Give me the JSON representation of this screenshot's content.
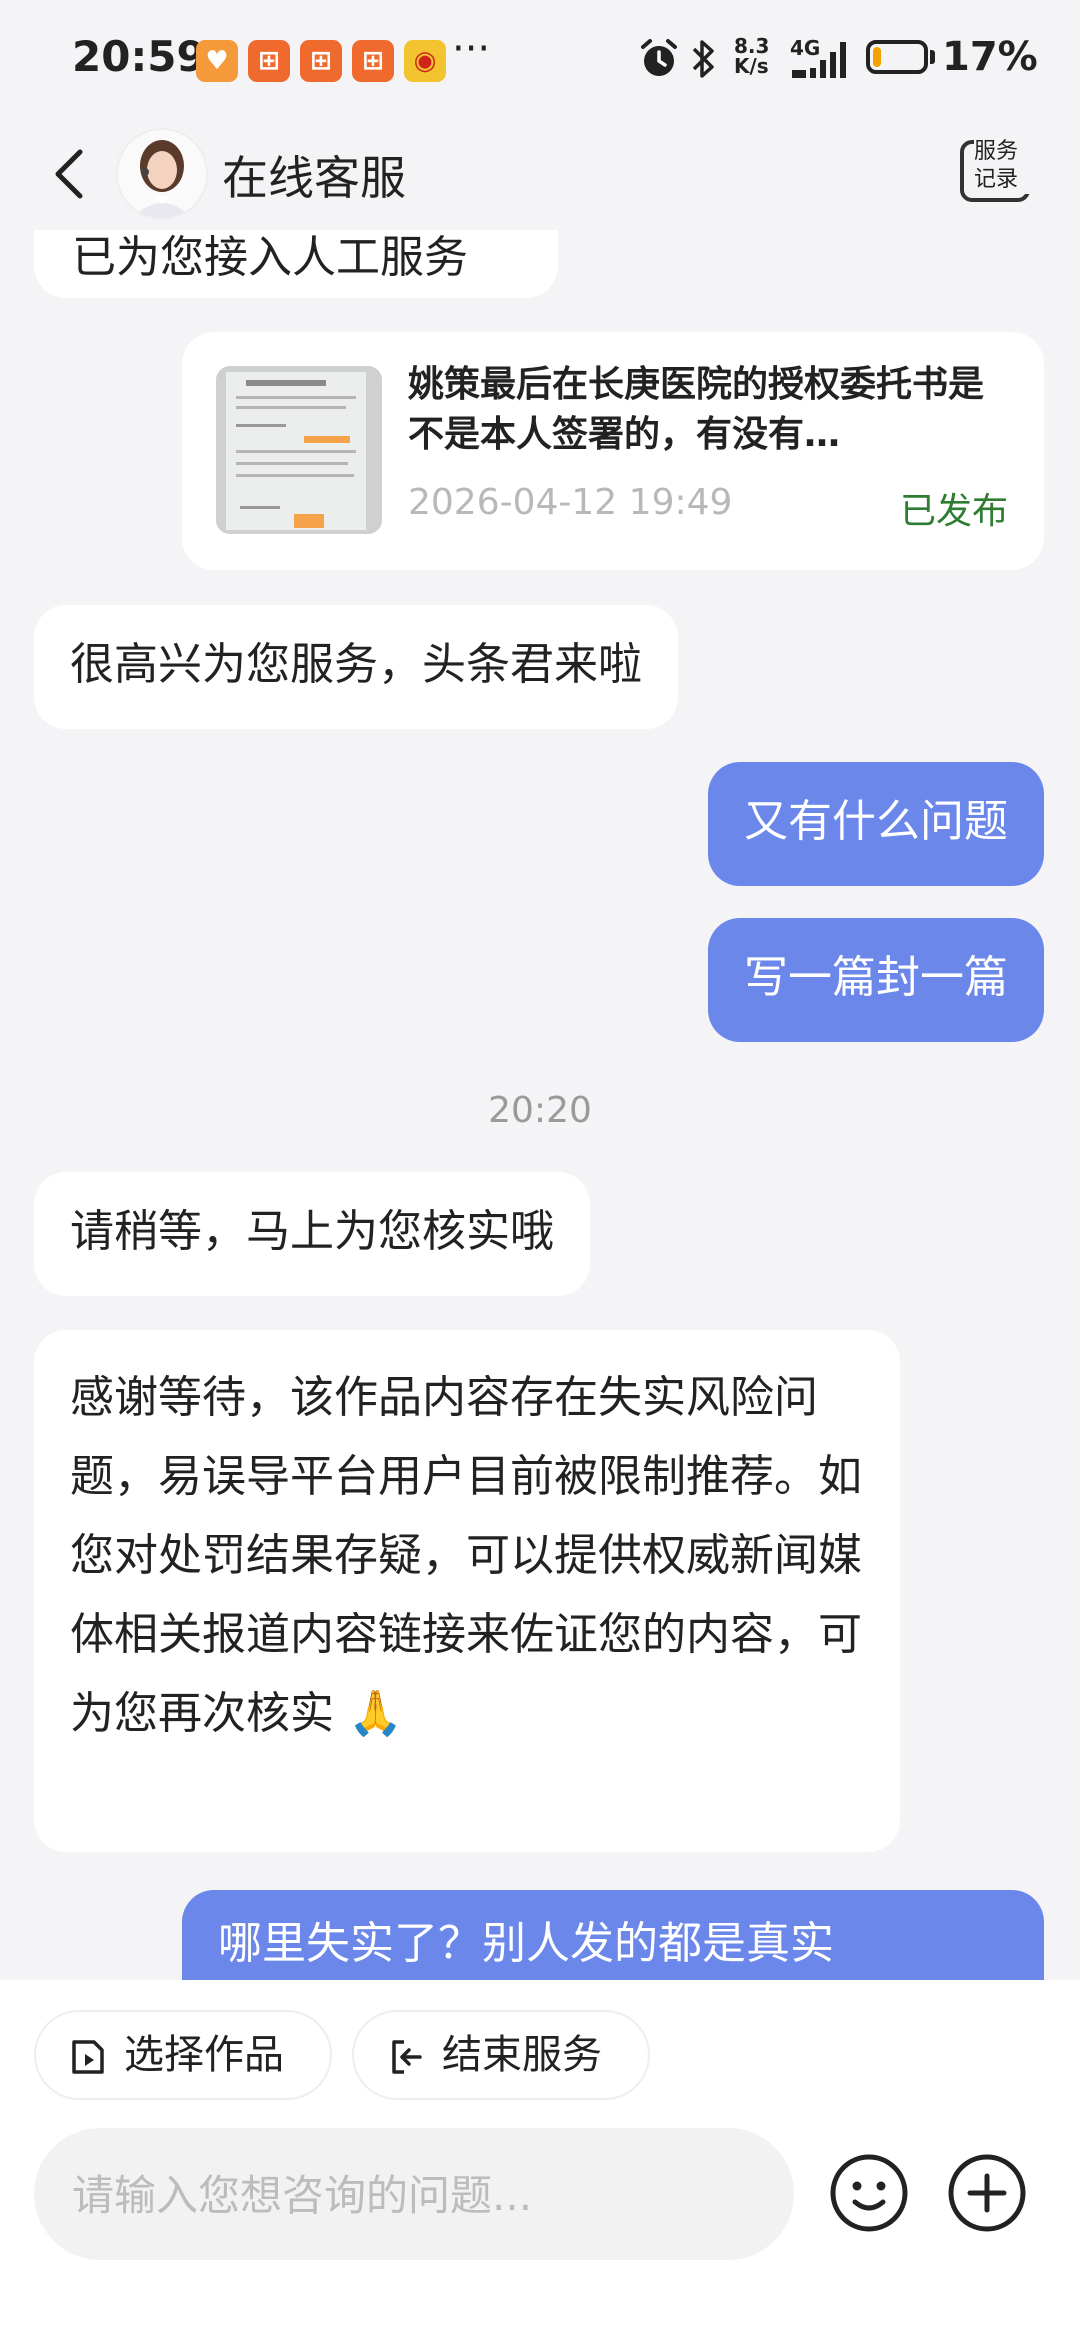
{
  "status_bar": {
    "time": "20:59",
    "apps": [
      {
        "icon": "heart-app-icon",
        "color": "#f59a3a",
        "glyph": "♥"
      },
      {
        "icon": "app-icon",
        "color": "#f06a2e",
        "glyph": "⊞"
      },
      {
        "icon": "app-icon",
        "color": "#f06a2e",
        "glyph": "⊞"
      },
      {
        "icon": "app-icon",
        "color": "#f06a2e",
        "glyph": "⊞"
      },
      {
        "icon": "weibo-icon",
        "color": "#f4c430",
        "glyph": "◉"
      }
    ],
    "more": "···",
    "net_speed_value": "8.3",
    "net_speed_unit": "K/s",
    "network": "4G",
    "battery_percent": 17,
    "battery_text": "17%"
  },
  "header": {
    "title": "在线客服",
    "record_label_line1": "服务",
    "record_label_line2": "记录"
  },
  "messages": {
    "partial_top": "已为您接入人工服务",
    "card": {
      "title": "姚策最后在长庚医院的授权委托书是不是本人签署的，有没有…",
      "date": "2026-04-12 19:49",
      "status": "已发布"
    },
    "greeting": "很高兴为您服务，头条君来啦",
    "user_1": "又有什么问题",
    "user_2": "写一篇封一篇",
    "time_separator": "20:20",
    "agent_wait": "请稍等，马上为您核实哦",
    "agent_reply": "感谢等待，该作品内容存在失实风险问题，易误导平台用户目前被限制推荐。如您对处罚结果存疑，可以提供权威新闻媒体相关报道内容链接来佐证您的内容，可为您再次核实",
    "agent_reply_emoji": "🙏",
    "user_3": "哪里失实了？别人发的都是真实"
  },
  "bottom": {
    "select_work": "选择作品",
    "end_service": "结束服务",
    "input_placeholder": "请输入您想咨询的问题..."
  }
}
